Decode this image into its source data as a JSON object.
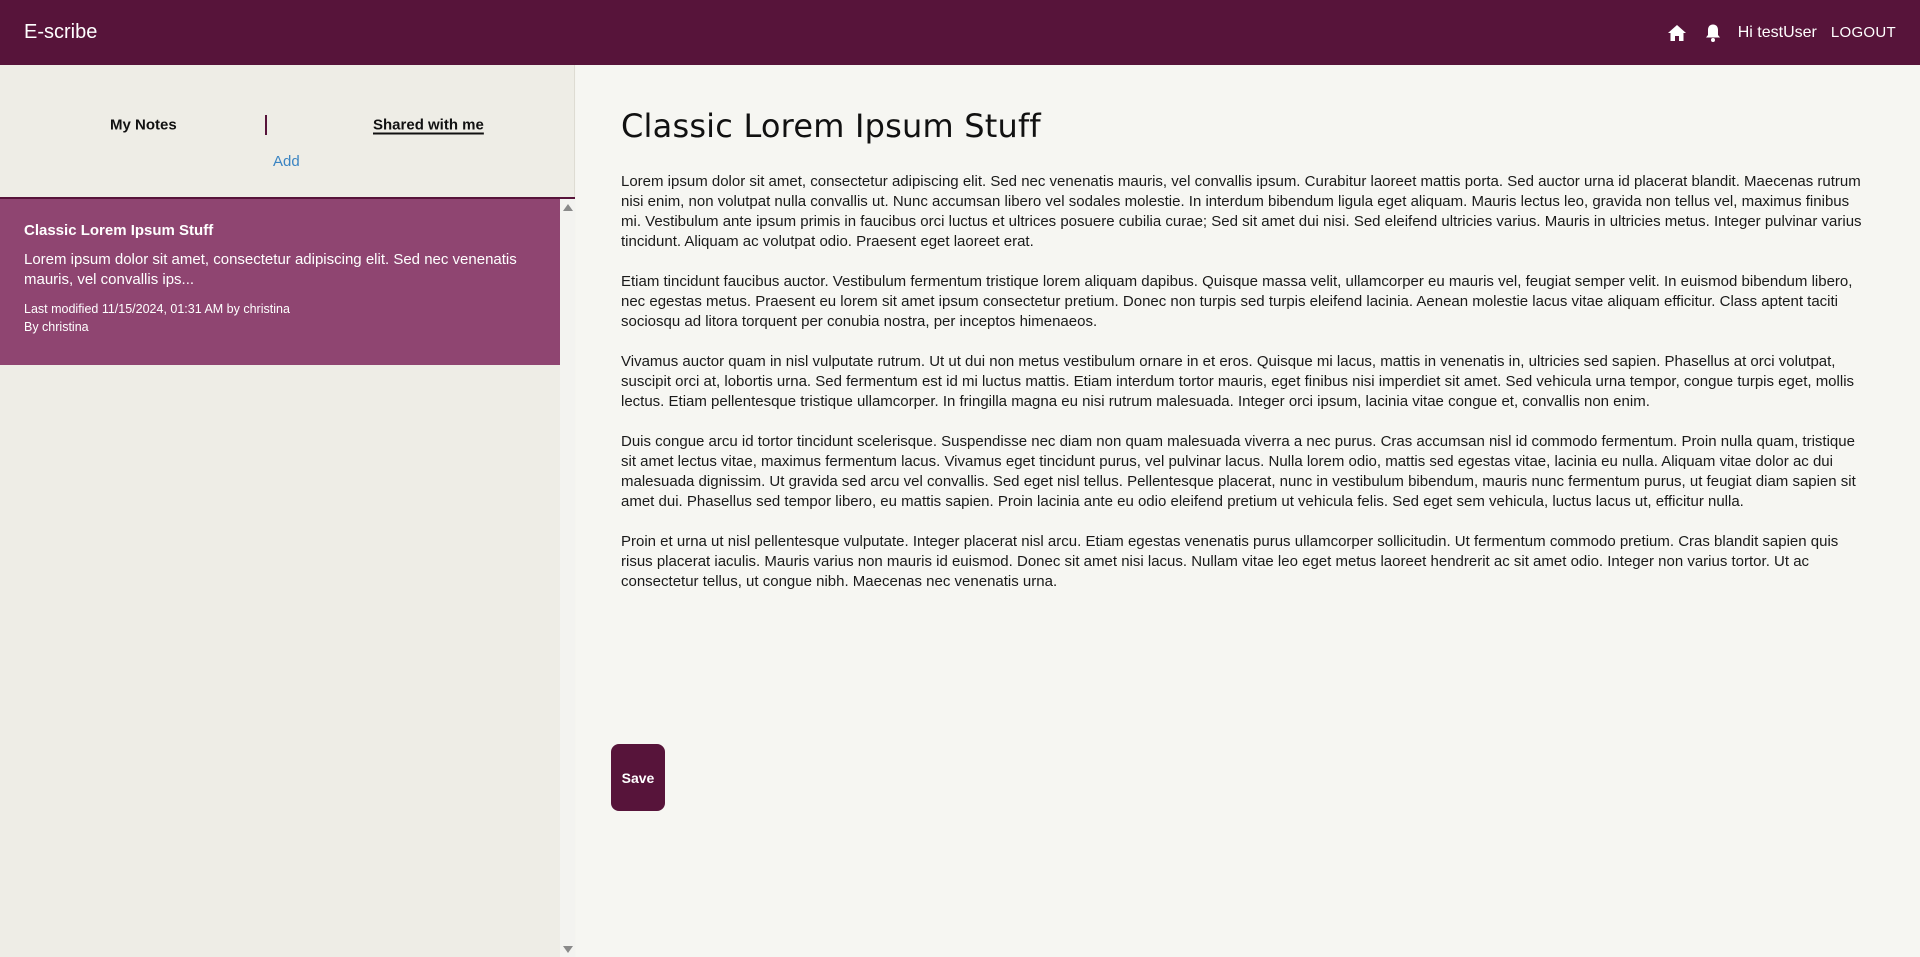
{
  "header": {
    "brand": "E-scribe",
    "greeting": "Hi testUser",
    "logout_label": "LOGOUT"
  },
  "sidebar": {
    "tabs": [
      {
        "label": "My Notes"
      },
      {
        "label": "Shared with me"
      }
    ],
    "add_label": "Add",
    "notes": [
      {
        "title": "Classic Lorem Ipsum Stuff",
        "preview": "Lorem ipsum dolor sit amet, consectetur adipiscing elit. Sed nec venenatis mauris, vel convallis ips...",
        "modified": "Last modified 11/15/2024, 01:31 AM by christina",
        "author": "By christina"
      }
    ]
  },
  "document": {
    "title": "Classic Lorem Ipsum Stuff",
    "paragraphs": [
      "Lorem ipsum dolor sit amet, consectetur adipiscing elit. Sed nec venenatis mauris, vel convallis ipsum. Curabitur laoreet mattis porta. Sed auctor urna id placerat blandit. Maecenas rutrum nisi enim, non volutpat nulla convallis ut. Nunc accumsan libero vel sodales molestie. In interdum bibendum ligula eget aliquam. Mauris lectus leo, gravida non tellus vel, maximus finibus mi. Vestibulum ante ipsum primis in faucibus orci luctus et ultrices posuere cubilia curae; Sed sit amet dui nisi. Sed eleifend ultricies varius. Mauris in ultricies metus. Integer pulvinar varius tincidunt. Aliquam ac volutpat odio. Praesent eget laoreet erat.",
      "Etiam tincidunt faucibus auctor. Vestibulum fermentum tristique lorem aliquam dapibus. Quisque massa velit, ullamcorper eu mauris vel, feugiat semper velit. In euismod bibendum libero, nec egestas metus. Praesent eu lorem sit amet ipsum consectetur pretium. Donec non turpis sed turpis eleifend lacinia. Aenean molestie lacus vitae aliquam efficitur. Class aptent taciti sociosqu ad litora torquent per conubia nostra, per inceptos himenaeos.",
      "Vivamus auctor quam in nisl vulputate rutrum. Ut ut dui non metus vestibulum ornare in et eros. Quisque mi lacus, mattis in venenatis in, ultricies sed sapien. Phasellus at orci volutpat, suscipit orci at, lobortis urna. Sed fermentum est id mi luctus mattis. Etiam interdum tortor mauris, eget finibus nisi imperdiet sit amet. Sed vehicula urna tempor, congue turpis eget, mollis lectus. Etiam pellentesque tristique ullamcorper. In fringilla magna eu nisi rutrum malesuada. Integer orci ipsum, lacinia vitae congue et, convallis non enim.",
      "Duis congue arcu id tortor tincidunt scelerisque. Suspendisse nec diam non quam malesuada viverra a nec purus. Cras accumsan nisl id commodo fermentum. Proin nulla quam, tristique sit amet lectus vitae, maximus fermentum lacus. Vivamus eget tincidunt purus, vel pulvinar lacus. Nulla lorem odio, mattis sed egestas vitae, lacinia eu nulla. Aliquam vitae dolor ac dui malesuada dignissim. Ut gravida sed arcu vel convallis. Sed eget nisl tellus. Pellentesque placerat, nunc in vestibulum bibendum, mauris nunc fermentum purus, ut feugiat diam sapien sit amet dui. Phasellus sed tempor libero, eu mattis sapien. Proin lacinia ante eu odio eleifend pretium ut vehicula felis. Sed eget sem vehicula, luctus lacus ut, efficitur nulla.",
      "Proin et urna ut nisl pellentesque vulputate. Integer placerat nisl arcu. Etiam egestas venenatis purus ullamcorper sollicitudin. Ut fermentum commodo pretium. Cras blandit sapien quis risus placerat iaculis. Mauris varius non mauris id euismod. Donec sit amet nisi lacus. Nullam vitae leo eget metus laoreet hendrerit ac sit amet odio. Integer non varius tortor. Ut ac consectetur tellus, ut congue nibh. Maecenas nec venenatis urna."
    ],
    "save_label": "Save"
  },
  "icons": {
    "home": "home-icon",
    "notifications": "bell-icon"
  },
  "colors": {
    "brand": "#57143a",
    "selected_note": "#8f4571",
    "link": "#3a84c2"
  }
}
